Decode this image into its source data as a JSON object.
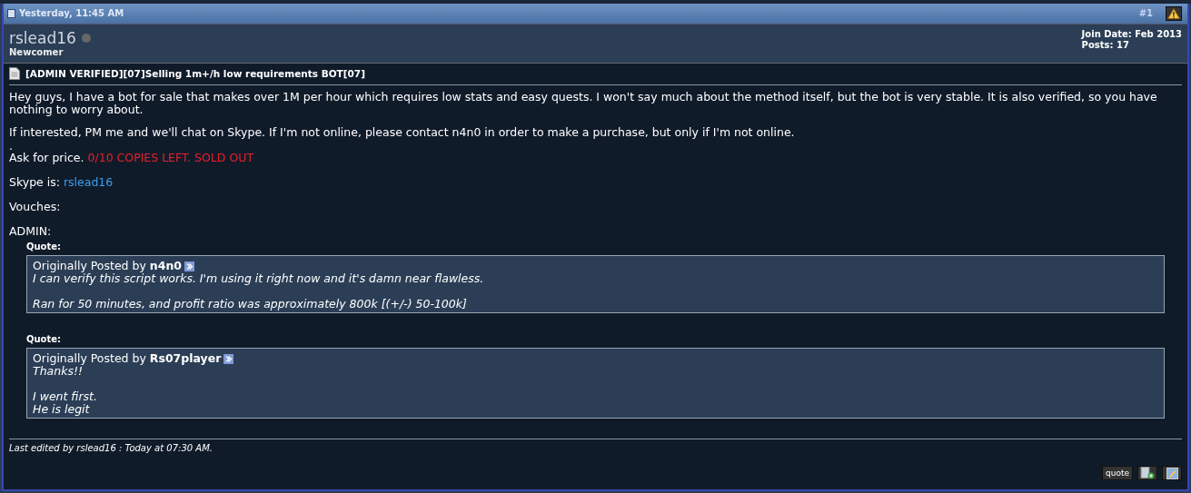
{
  "post": {
    "date": "Yesterday, 11:45 AM",
    "number": "#1",
    "author": {
      "name": "rslead16",
      "online": false,
      "rank": "Newcomer",
      "join_date": "Join Date: Feb 2013",
      "posts": "Posts: 17"
    },
    "title": "[ADMIN VERIFIED][07]Selling 1m+/h low requirements BOT[07]",
    "body": [
      {
        "kind": "text",
        "text": "Hey guys, I have a bot for sale that makes over 1M per hour which requires low stats and easy quests. I won't say much about the method itself, but the bot is very stable. It is also verified, so you have nothing to worry about."
      },
      {
        "kind": "text",
        "text": "If interested, PM me and we'll chat on Skype. If I'm not online, please contact n4n0 in order to make a purchase, but only if I'm not online."
      },
      {
        "kind": "dot",
        "text": "."
      },
      {
        "kind": "alert",
        "text": "Ask for price.",
        "extra": "0/10 COPIES LEFT. SOLD OUT"
      },
      {
        "kind": "link",
        "text": "Skype is:",
        "extra": "rslead16"
      },
      {
        "kind": "text",
        "text": "Vouches:"
      },
      {
        "kind": "text",
        "text": "ADMIN:"
      }
    ],
    "quotes": [
      {
        "label": "Quote:",
        "prefix": "Originally Posted by",
        "author": "n4n0",
        "paragraphs": [
          [
            "I can verify this script works. I'm using it right now and it's damn near flawless."
          ],
          [
            "Ran for 50 minutes, and profit ratio was approximately 800k [(+/-) 50-100k]"
          ]
        ]
      },
      {
        "label": "Quote:",
        "prefix": "Originally Posted by",
        "author": "Rs07player",
        "paragraphs": [
          [
            "Thanks!!"
          ],
          [
            "I went first.",
            "He is legit"
          ]
        ]
      }
    ],
    "edited": "Last edited by rslead16 : Today at 07:30 AM.",
    "buttons": [
      {
        "kind": "quote",
        "label": "quote"
      },
      {
        "kind": "multiquote"
      },
      {
        "kind": "edit"
      }
    ]
  }
}
